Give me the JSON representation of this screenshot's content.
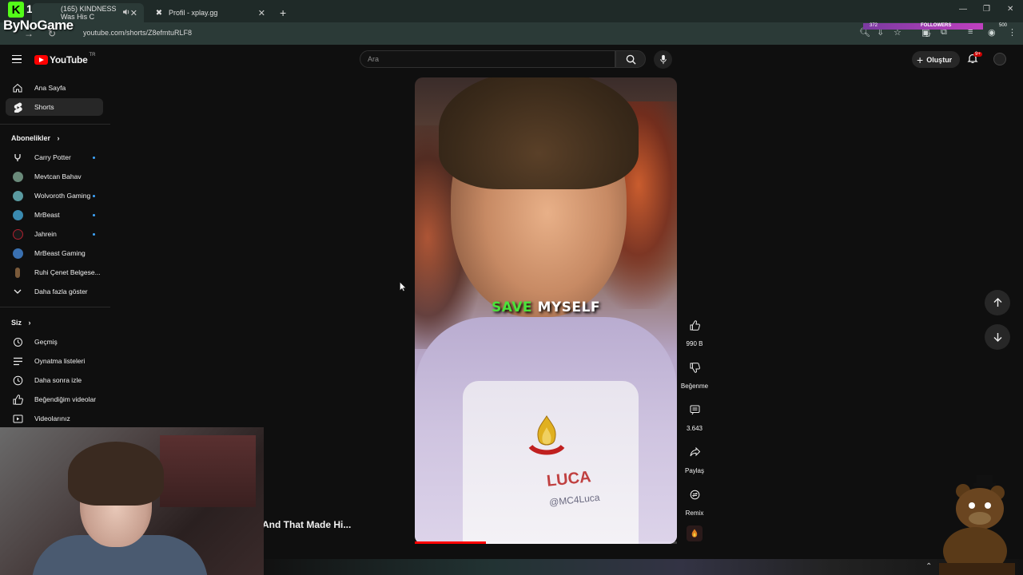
{
  "browser": {
    "tabs": [
      {
        "title": "(165) KINDNESS Was His C"
      },
      {
        "title": "Profil - xplay.gg"
      }
    ],
    "new_tab": "+",
    "url": "youtube.com/shorts/Z8efmtuRLF8",
    "overlay_brand": "ByNoGame",
    "kick_number": "1",
    "followers_label": "FOLLOWERS",
    "followers_left": "372",
    "followers_right": "500",
    "ext_badge": "17"
  },
  "youtube": {
    "logo_text": "YouTube",
    "country": "TR",
    "search_placeholder": "Ara",
    "create_label": "Oluştur",
    "notif_count": "9+"
  },
  "sidebar": {
    "main": [
      {
        "label": "Ana Sayfa",
        "icon": "home-icon"
      },
      {
        "label": "Shorts",
        "icon": "shorts-icon"
      }
    ],
    "subs_heading": "Abonelikler",
    "subscriptions": [
      {
        "label": "Carry Potter",
        "dot": true,
        "color": "#2a2a2a"
      },
      {
        "label": "Mevtcan Bahav",
        "dot": false,
        "color": "#6a8a7a"
      },
      {
        "label": "Wolvoroth Gaming",
        "dot": true,
        "color": "#5a9aa0"
      },
      {
        "label": "MrBeast",
        "dot": true,
        "color": "#3a8ab0"
      },
      {
        "label": "Jahrein",
        "dot": true,
        "color": "#b02030"
      },
      {
        "label": "MrBeast Gaming",
        "dot": false,
        "color": "#3a70b0"
      },
      {
        "label": "Ruhi Çenet Belgese...",
        "dot": false,
        "color": "#7a5a3a"
      }
    ],
    "show_more": "Daha fazla göster",
    "you_heading": "Siz",
    "you_items": [
      {
        "label": "Geçmiş",
        "icon": "history-icon"
      },
      {
        "label": "Oynatma listeleri",
        "icon": "playlist-icon"
      },
      {
        "label": "Daha sonra izle",
        "icon": "clock-icon"
      },
      {
        "label": "Beğendiğim videolar",
        "icon": "thumbs-up-icon"
      },
      {
        "label": "Videolarınız",
        "icon": "video-icon"
      }
    ]
  },
  "short": {
    "caption_word1": "SAVE",
    "caption_word2": "MYSELF",
    "name_tag": "LUCA",
    "handle_tag": "@MC4Luca",
    "progress": 0.27,
    "next_title": "And That Made Hi..."
  },
  "actions": {
    "like_count": "990 B",
    "dislike_label": "Beğenme",
    "comment_count": "3.643",
    "share_label": "Paylaş",
    "remix_label": "Remix"
  }
}
